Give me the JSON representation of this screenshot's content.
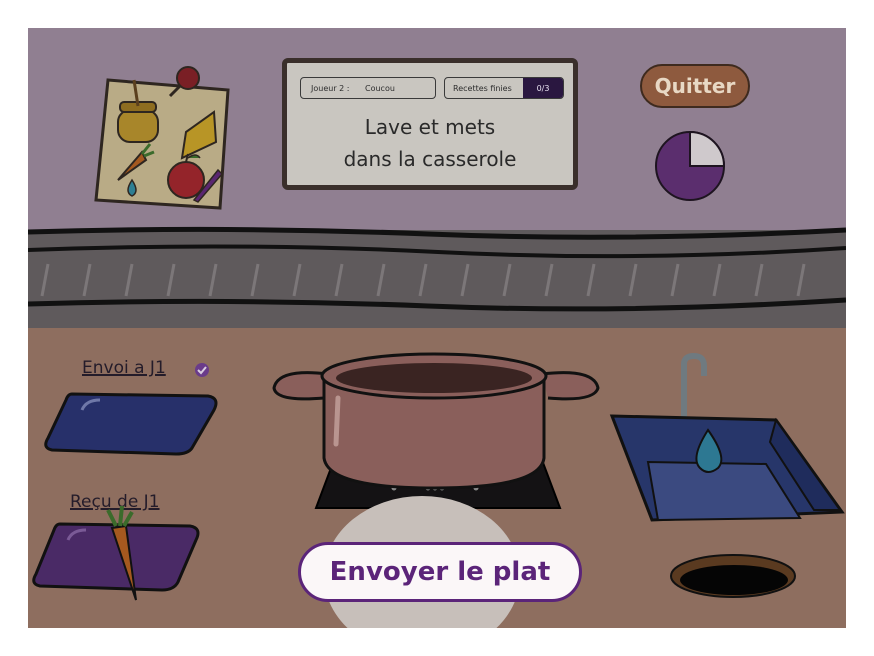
{
  "header": {
    "player_label": "Joueur 2 :",
    "player_name": "Coucou",
    "recipes_label": "Recettes finies",
    "recipes_count": "0/3",
    "instruction_line1": "Lave et mets",
    "instruction_line2": "dans la casserole"
  },
  "controls": {
    "quit_label": "Quitter",
    "send_dish_label": "Envoyer le plat"
  },
  "timer": {
    "elapsed_fraction": 0.25
  },
  "zones": {
    "send_label": "Envoi a J1",
    "receive_label": "Reçu de J1"
  },
  "recipe_card_items": [
    "honey-jar-icon",
    "cheese-icon",
    "carrot-icon",
    "water-drop-icon",
    "apple-icon",
    "knife-icon"
  ],
  "received_item": "carrot-icon",
  "colors": {
    "accent": "#5b2479",
    "quit_button": "#8e5a3e",
    "counter": "#8e6e5f",
    "wall": "#907f91",
    "recipes_counter_bg": "#2a1740"
  }
}
